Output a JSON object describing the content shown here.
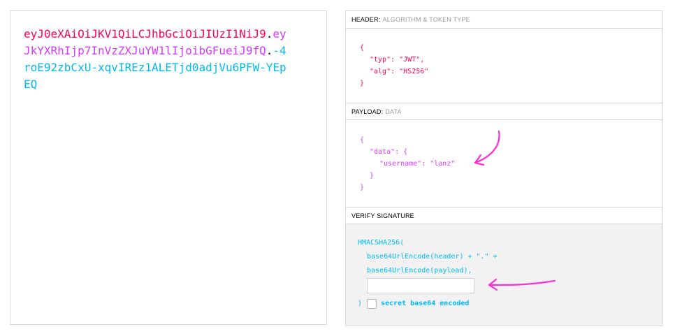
{
  "encoded": {
    "header_part": "eyJ0eXAiOiJKV1QiLCJhbGciOiJIUzI1NiJ9",
    "dot1": ".",
    "payload_part": "eyJkYXRhIjp7InVzZXJuYW1lIjoibGFueiJ9fQ",
    "dot2": ".",
    "signature_part": "-4roE92zbCxU-xqvIREz1ALETjd0adjVu6PFW-YEpEQ"
  },
  "header_section": {
    "title": "HEADER:",
    "subtitle": "ALGORITHM & TOKEN TYPE",
    "lines": [
      "{",
      "\"typ\": \"JWT\",",
      "\"alg\": \"HS256\"",
      "}"
    ]
  },
  "payload_section": {
    "title": "PAYLOAD:",
    "subtitle": "DATA",
    "lines": [
      "{",
      "\"data\": {",
      "\"username\": \"lanz\"",
      "}",
      "}"
    ]
  },
  "verify_section": {
    "title": "VERIFY SIGNATURE",
    "fn": "HMACSHA256(",
    "arg1": "base64UrlEncode(header) + \".\" +",
    "arg2": "base64UrlEncode(payload),",
    "secret_value": "",
    "close": ")",
    "checkbox_label": "secret base64 encoded",
    "checkbox_checked": false
  },
  "colors": {
    "header": "#fb015b",
    "payload": "#d63aff",
    "signature": "#00b9f1",
    "annotation": "#ff2ed6"
  },
  "icons": [
    "annotation-arrow-icon"
  ]
}
